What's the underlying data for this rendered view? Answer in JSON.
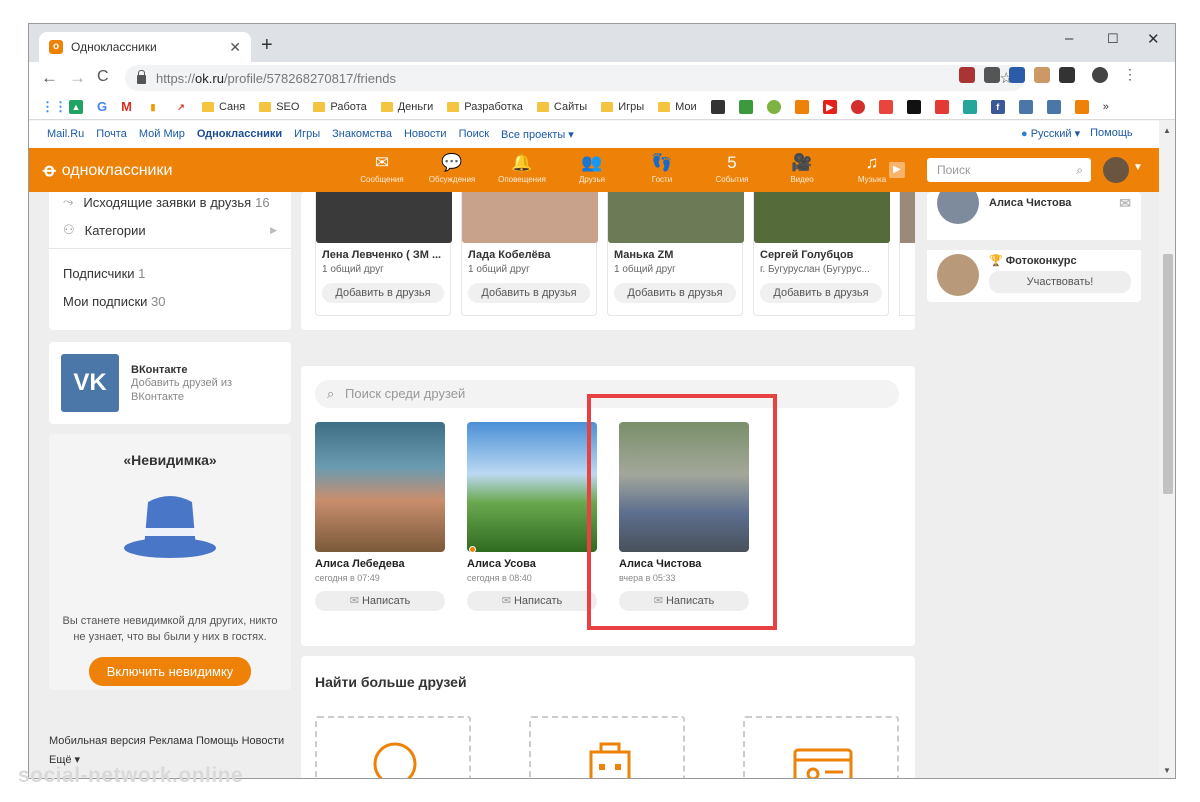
{
  "browser": {
    "tab_title": "Одноклассники",
    "url_prefix": "https://",
    "url_domain": "ok.ru",
    "url_path": "/profile/578268270817/friends"
  },
  "bookmarks": [
    {
      "label": "Саня"
    },
    {
      "label": "SEO"
    },
    {
      "label": "Работа"
    },
    {
      "label": "Деньги"
    },
    {
      "label": "Разработка"
    },
    {
      "label": "Сайты"
    },
    {
      "label": "Игры"
    },
    {
      "label": "Мои"
    }
  ],
  "bookmark_letters": {
    "a": "G",
    "b": "M",
    "more": "»"
  },
  "mailru_bar": {
    "items": [
      "Mail.Ru",
      "Почта",
      "Мой Мир",
      "Одноклассники",
      "Игры",
      "Знакомства",
      "Новости",
      "Поиск",
      "Все проекты ▾"
    ],
    "language": "Русский ▾",
    "help": "Помощь"
  },
  "ok_header": {
    "logo_text": "одноклассники",
    "menu": [
      {
        "icon": "✉",
        "label": "Сообщения"
      },
      {
        "icon": "💬",
        "label": "Обсуждения"
      },
      {
        "icon": "🔔",
        "label": "Оповещения"
      },
      {
        "icon": "👥",
        "label": "Друзья"
      },
      {
        "icon": "👣",
        "label": "Гости"
      },
      {
        "icon": "5",
        "label": "События"
      },
      {
        "icon": "🎥",
        "label": "Видео"
      },
      {
        "icon": "♫",
        "label": "Музыка"
      }
    ],
    "search_placeholder": "Поиск"
  },
  "left_col": {
    "outgoing_label": "Исходящие заявки в друзья",
    "outgoing_count": "16",
    "categories": "Категории",
    "subscribers_label": "Подписчики",
    "subscribers_count": "1",
    "subscriptions_label": "Мои подписки",
    "subscriptions_count": "30",
    "vk_title": "ВКонтакте",
    "vk_desc": "Добавить друзей из ВКонтакте",
    "invisible_title": "«Невидимка»",
    "invisible_desc": "Вы станете невидимкой для других, никто не узнает, что вы были у них в гостях.",
    "invisible_button": "Включить невидимку",
    "footer_links": [
      "Мобильная версия",
      "Реклама",
      "Помощь",
      "Новости"
    ],
    "footer_more": "Ещё ▾"
  },
  "suggestions": [
    {
      "name": "Лена Левченко ( ЗМ ...",
      "sub": "1 общий друг",
      "button": "Добавить в друзья",
      "color": "#3a3a3a"
    },
    {
      "name": "Лада Кобелёва",
      "sub": "1 общий друг",
      "button": "Добавить в друзья",
      "color": "#c9a28c"
    },
    {
      "name": "Манька ZM",
      "sub": "1 общий друг",
      "button": "Добавить в друзья",
      "color": "#6c7a55"
    },
    {
      "name": "Сергей Голубцов",
      "sub": "г. Бугуруслан (Бугурус...",
      "button": "Добавить в друзья",
      "color": "#556b3a"
    }
  ],
  "friends": {
    "search_placeholder": "Поиск среди друзей",
    "items": [
      {
        "name": "Алиса Лебедева",
        "time": "сегодня в 07:49",
        "button": "Написать"
      },
      {
        "name": "Алиса Усова",
        "time": "сегодня в 08:40",
        "button": "Написать"
      },
      {
        "name": "Алиса Чистова",
        "time": "вчера в 05:33",
        "button": "Написать"
      }
    ]
  },
  "find_more": {
    "title": "Найти больше друзей"
  },
  "right_col": {
    "friend_name": "Алиса Чистова",
    "contest_label": "Фотоконкурс",
    "contest_button": "Участвовать!"
  },
  "watermark": "social-network.online",
  "colors": {
    "ok_orange": "#ee8208",
    "highlight_red": "#e84142",
    "vk_blue": "#4a76a8"
  }
}
